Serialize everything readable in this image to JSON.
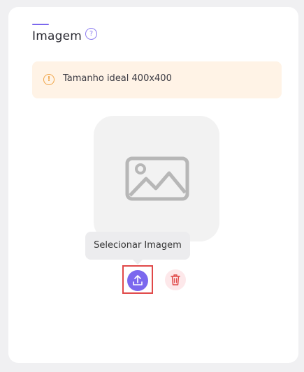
{
  "section": {
    "title": "Imagem",
    "help_icon": "question-circle-icon"
  },
  "alert": {
    "icon": "warning-circle-icon",
    "text": "Tamanho ideal 400x400"
  },
  "image_picker": {
    "placeholder_icon": "image-icon",
    "tooltip": "Selecionar Imagem",
    "upload_icon": "upload-icon",
    "delete_icon": "trash-icon"
  },
  "colors": {
    "accent": "#7b68ee",
    "alert_bg": "#fff3e6",
    "alert_icon": "#f0a548",
    "delete_bg": "#fde8ea",
    "delete_icon": "#e04848",
    "highlight_border": "#e04848"
  }
}
